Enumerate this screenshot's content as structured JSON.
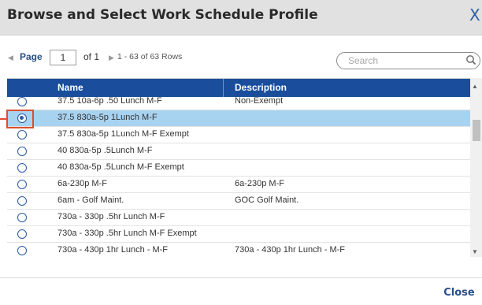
{
  "dialog": {
    "title": "Browse and Select Work Schedule Profile",
    "close_glyph": "X",
    "close_button_label": "Close"
  },
  "pager": {
    "prev_glyph": "◀",
    "next_glyph": "▶",
    "page_label": "Page",
    "current_page": "1",
    "of_label": "of 1",
    "rows_label": "1 - 63 of 63 Rows"
  },
  "search": {
    "placeholder": "Search",
    "icon": "search-icon"
  },
  "grid": {
    "columns": [
      "Name",
      "Description"
    ],
    "rows": [
      {
        "name": "37.5 10a-6p .50 Lunch M-F",
        "description": "Non-Exempt",
        "selected": false
      },
      {
        "name": "37.5 830a-5p 1Lunch M-F",
        "description": "",
        "selected": true
      },
      {
        "name": "37.5 830a-5p 1Lunch M-F Exempt",
        "description": "",
        "selected": false
      },
      {
        "name": "40 830a-5p .5Lunch M-F",
        "description": "",
        "selected": false
      },
      {
        "name": "40 830a-5p .5Lunch M-F Exempt",
        "description": "",
        "selected": false
      },
      {
        "name": "6a-230p M-F",
        "description": "6a-230p M-F",
        "selected": false
      },
      {
        "name": "6am - Golf Maint.",
        "description": "GOC Golf Maint.",
        "selected": false
      },
      {
        "name": "730a - 330p .5hr Lunch M-F",
        "description": "",
        "selected": false
      },
      {
        "name": "730a - 330p .5hr Lunch M-F Exempt",
        "description": "",
        "selected": false
      },
      {
        "name": "730a - 430p 1hr Lunch - M-F",
        "description": "730a - 430p 1hr Lunch - M-F",
        "selected": false
      }
    ]
  },
  "colors": {
    "header_bg": "#1a4e9c",
    "selected_row": "#a7d2f0",
    "callout": "#d9502e",
    "titlebar": "#e1e1e1"
  }
}
